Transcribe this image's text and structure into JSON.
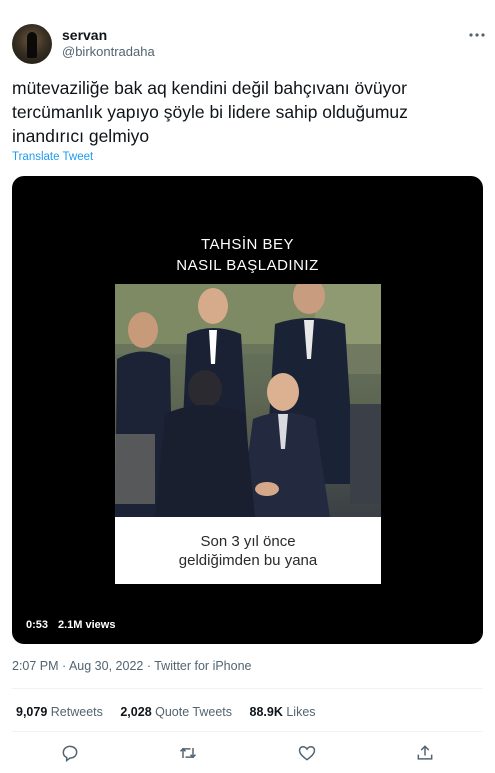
{
  "user": {
    "display_name": "servan",
    "handle": "@birkontradaha"
  },
  "tweet": {
    "text": "mütevaziliğe bak aq kendini değil bahçıvanı övüyor\ntercümanlık yapıyo şöyle bi lidere sahip olduğumuz\ninandırıcı gelmiyo",
    "translate_label": "Translate Tweet"
  },
  "video": {
    "title_line1": "TAHSİN BEY",
    "title_line2": "NASIL BAŞLADINIZ",
    "caption": "Son 3 yıl önce\ngeldiğimden bu yana",
    "time": "0:53",
    "views": "2.1M views"
  },
  "meta": {
    "timestamp": "2:07 PM · Aug 30, 2022 · Twitter for iPhone"
  },
  "stats": {
    "retweets_count": "9,079",
    "retweets_label": "Retweets",
    "quotes_count": "2,028",
    "quotes_label": "Quote Tweets",
    "likes_count": "88.9K",
    "likes_label": "Likes"
  },
  "icons": {
    "more": "more-icon",
    "reply": "reply-icon",
    "retweet": "retweet-icon",
    "like": "heart-icon",
    "share": "share-icon"
  },
  "colors": {
    "accent": "#1d9bf0",
    "secondary_text": "#536471",
    "primary_text": "#0f1419",
    "divider": "#eff3f4"
  }
}
